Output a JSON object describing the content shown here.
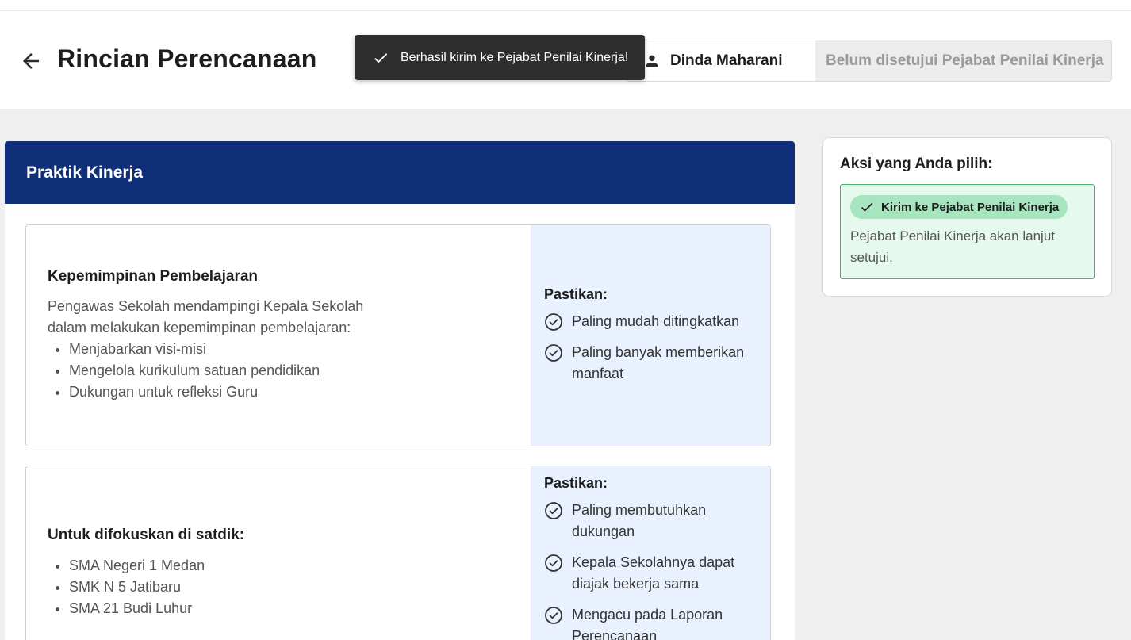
{
  "header": {
    "title": "Rincian Perencanaan",
    "user_name": "Dinda Maharani",
    "status": "Belum disetujui Pejabat Penilai Kinerja"
  },
  "toast": {
    "message": "Berhasil kirim ke Pejabat Penilai Kinerja!"
  },
  "section": {
    "title": "Praktik Kinerja",
    "items": [
      {
        "heading": "Kepemimpinan Pembelajaran",
        "description": "Pengawas Sekolah mendampingi Kepala Sekolah dalam melakukan kepemimpinan pembelajaran:",
        "bullets": [
          "Menjabarkan visi-misi",
          "Mengelola kurikulum satuan pendidikan",
          "Dukungan untuk refleksi Guru"
        ],
        "pastikan_label": "Pastikan:",
        "checks": [
          "Paling mudah ditingkatkan",
          "Paling banyak memberikan manfaat"
        ]
      },
      {
        "heading": "Untuk difokuskan di satdik:",
        "bullets": [
          "SMA Negeri 1 Medan",
          "SMK N 5 Jatibaru",
          "SMA 21 Budi Luhur"
        ],
        "pastikan_label": "Pastikan:",
        "checks": [
          "Paling membutuhkan dukungan",
          "Kepala Sekolahnya dapat diajak bekerja sama",
          "Mengacu pada Laporan Perencanaan"
        ]
      }
    ]
  },
  "action_panel": {
    "title": "Aksi yang Anda pilih:",
    "pill_label": "Kirim ke Pejabat Penilai Kinerja",
    "description": "Pejabat Penilai Kinerja akan lanjut setujui."
  },
  "colors": {
    "primary_navy": "#0f2f78",
    "success_green": "#45b36b",
    "pill_green": "#a6e5bd",
    "info_blue_bg": "#e8f1fd",
    "toast_bg": "#2e2e2e"
  },
  "icons": [
    "arrow-left-icon",
    "check-icon",
    "person-icon",
    "check-circle-icon"
  ]
}
